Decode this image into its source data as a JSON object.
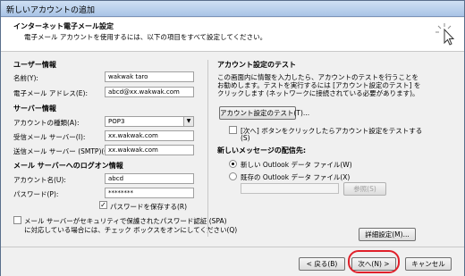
{
  "window": {
    "title": "新しいアカウントの追加"
  },
  "header": {
    "title": "インターネット電子メール設定",
    "subtitle": "電子メール アカウントを使用するには、以下の項目をすべて設定してください。",
    "icon": "cursor-click-icon"
  },
  "user_info": {
    "heading": "ユーザー情報",
    "name_label": "名前(Y):",
    "name_value": "wakwak taro",
    "email_label": "電子メール アドレス(E):",
    "email_value": "abcd@xx.wakwak.com"
  },
  "server_info": {
    "heading": "サーバー情報",
    "account_type_label": "アカウントの種類(A):",
    "account_type_value": "POP3",
    "incoming_label": "受信メール サーバー(I):",
    "incoming_value": "xx.wakwak.com",
    "outgoing_label": "送信メール サーバー (SMTP)(O):",
    "outgoing_value": "xx.wakwak.com"
  },
  "logon_info": {
    "heading": "メール サーバーへのログオン情報",
    "account_name_label": "アカウント名(U):",
    "account_name_value": "abcd",
    "password_label": "パスワード(P):",
    "password_value": "********",
    "remember_label": "パスワードを保存する(R)",
    "remember_checked": true,
    "spa_label_line1": "メール サーバーがセキュリティで保護されたパスワード認証 (SPA)",
    "spa_label_line2": "に対応している場合には、チェック ボックスをオンにしてください(Q)",
    "spa_checked": false
  },
  "test": {
    "heading": "アカウント設定のテスト",
    "desc1": "この画面内に情報を入力したら、アカウントのテストを行うことを",
    "desc2": "お勧めします。テストを実行するには [アカウント設定のテスト] を",
    "desc3": "クリックします (ネットワークに接続されている必要があります)。",
    "test_button": "アカウント設定のテスト(T)...",
    "auto_test_line1": "[次へ] ボタンをクリックしたらアカウント設定をテストする",
    "auto_test_line2": "(S)",
    "auto_test_checked": false
  },
  "delivery": {
    "heading": "新しいメッセージの配信先:",
    "option_new": "新しい Outlook データ ファイル(W)",
    "option_existing": "既存の Outlook データ ファイル(X)",
    "browse_button": "参照(S)",
    "selected": "new"
  },
  "more_settings_button": "詳細設定(M)...",
  "footer": {
    "back_button": "< 戻る(B)",
    "next_button": "次へ(N) >",
    "cancel_button": "キャンセル"
  }
}
